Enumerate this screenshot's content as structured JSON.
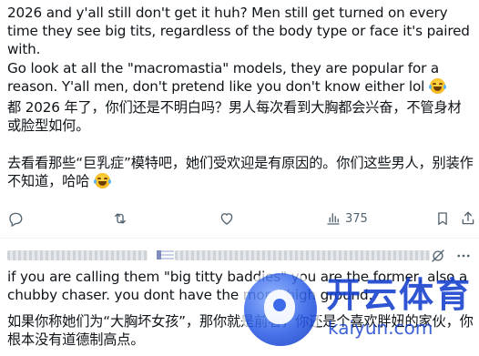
{
  "post": {
    "paragraph_1": "2026 and y'all still don't get it huh? Men still get turned on every time they see big tits, regardless of the body type or face it's paired with.",
    "paragraph_2": "Go look at all the \"macromastia\" models, they are popular for a reason. Y'all men, don't pretend like you don't know either lol",
    "paragraph_3": "都 2026 年了，你们还是不明白吗？男人每次看到大胸都会兴奋，不管身材或脸型如何。",
    "paragraph_4": "去看看那些“巨乳症”模特吧，她们受欢迎是有原因的。你们这些男人，别装作不知道，哈哈",
    "emoji_name": "face-with-tears-of-joy"
  },
  "actions": {
    "reply_icon": "reply-icon",
    "repost_icon": "repost-icon",
    "like_icon": "like-icon",
    "views_icon": "views-icon",
    "views_count": "375",
    "bookmark_icon": "bookmark-icon",
    "share_icon": "share-icon"
  },
  "reply": {
    "author_redacted": true,
    "grok_icon": "grok-icon",
    "more_icon": "more-icon",
    "paragraph_1": "if you are calling them \"big titty baddies\" you are the former, also a chubby chaser. you dont have the moral high ground.",
    "paragraph_2": "如果你称她们为“大胸坏女孩”，那你就是前者，你还是个喜欢胖妞的家伙，你根本没有道德制高点。"
  },
  "watermark": {
    "title": "开云体育",
    "subtitle": "kaiyun.com",
    "color": "#123ecd"
  },
  "colors": {
    "text": "#0f1419",
    "muted": "#536471",
    "divider": "#eff3f4"
  }
}
